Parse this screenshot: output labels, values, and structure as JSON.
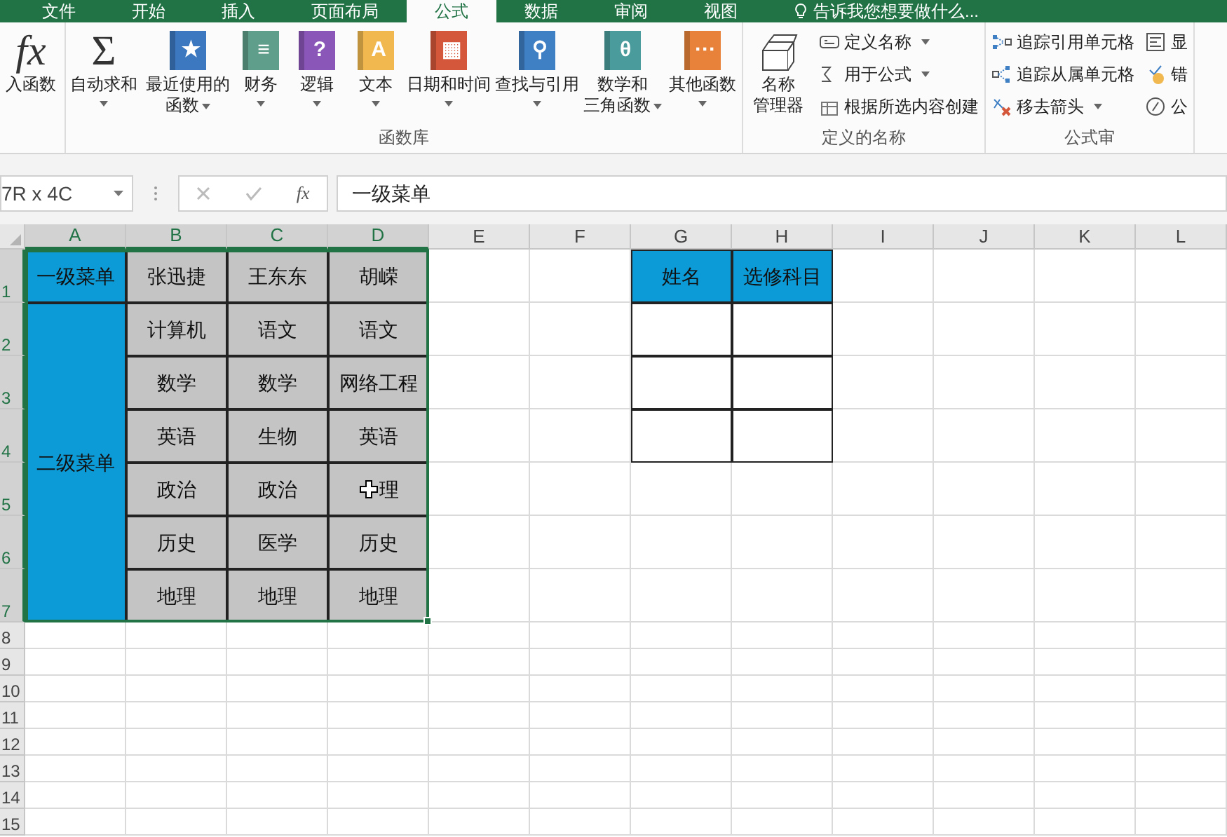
{
  "tabs": [
    {
      "label": "文件",
      "selected": false
    },
    {
      "label": "开始",
      "selected": false
    },
    {
      "label": "插入",
      "selected": false
    },
    {
      "label": "页面布局",
      "selected": false
    },
    {
      "label": "公式",
      "selected": true
    },
    {
      "label": "数据",
      "selected": false
    },
    {
      "label": "审阅",
      "selected": false
    },
    {
      "label": "视图",
      "selected": false
    }
  ],
  "tell_me": "告诉我您想要做什么...",
  "ribbon_groups": [
    {
      "items": [
        {
          "kind": "large",
          "glyph": "fx",
          "lines": [
            "入函数"
          ],
          "dropdown": false
        }
      ]
    },
    {
      "label": "函数库",
      "items": [
        {
          "kind": "large",
          "glyph": "Σ",
          "lines": [
            "自动求和"
          ],
          "dropdown": true
        },
        {
          "kind": "large",
          "glyph": "★",
          "color": "#3b78c0",
          "lines": [
            "最近使用的",
            "函数"
          ],
          "dropdown": true
        },
        {
          "kind": "large",
          "glyph": "≡",
          "color": "#5f9e8a",
          "lines": [
            "财务"
          ],
          "dropdown": true
        },
        {
          "kind": "large",
          "glyph": "?",
          "color": "#8a56b8",
          "lines": [
            "逻辑"
          ],
          "dropdown": true
        },
        {
          "kind": "large",
          "glyph": "A",
          "color": "#f0b84e",
          "lines": [
            "文本"
          ],
          "dropdown": true
        },
        {
          "kind": "large",
          "glyph": "▦",
          "color": "#d4573b",
          "lines": [
            "日期和时间"
          ],
          "dropdown": true
        },
        {
          "kind": "large",
          "glyph": "⚲",
          "color": "#3f7fc4",
          "lines": [
            "查找与引用"
          ],
          "dropdown": true
        },
        {
          "kind": "large",
          "glyph": "θ",
          "color": "#4a9b9b",
          "lines": [
            "数学和",
            "三角函数"
          ],
          "dropdown": true
        },
        {
          "kind": "large",
          "glyph": "···",
          "color": "#e8823a",
          "lines": [
            "其他函数"
          ],
          "dropdown": true
        }
      ]
    },
    {
      "label": "定义的名称",
      "items": [
        {
          "kind": "large",
          "lines": [
            "名称",
            "管理器"
          ],
          "dropdown": false
        },
        {
          "kind": "small",
          "lines": [
            "定义名称"
          ],
          "dropdown": true
        },
        {
          "kind": "small",
          "lines": [
            "用于公式"
          ],
          "dropdown": true
        },
        {
          "kind": "small",
          "lines": [
            "根据所选内容创建"
          ],
          "dropdown": false
        }
      ]
    },
    {
      "label": "公式审",
      "items": [
        {
          "kind": "small",
          "lines": [
            "追踪引用单元格"
          ],
          "dropdown": false
        },
        {
          "kind": "small",
          "lines": [
            "追踪从属单元格"
          ],
          "dropdown": false
        },
        {
          "kind": "small",
          "lines": [
            "移去箭头"
          ],
          "dropdown": true
        },
        {
          "kind": "small",
          "lines": [
            "显"
          ],
          "dropdown": false
        },
        {
          "kind": "small",
          "lines": [
            "错"
          ],
          "dropdown": false
        },
        {
          "kind": "small",
          "lines": [
            "公"
          ],
          "dropdown": false
        }
      ]
    }
  ],
  "formula_bar": {
    "name_box": "7R x 4C",
    "fx": "fx",
    "value": "一级菜单"
  },
  "columns": [
    {
      "label": "A",
      "selected": true
    },
    {
      "label": "B",
      "selected": true
    },
    {
      "label": "C",
      "selected": true
    },
    {
      "label": "D",
      "selected": true
    },
    {
      "label": "E",
      "selected": false
    },
    {
      "label": "F",
      "selected": false
    },
    {
      "label": "G",
      "selected": false
    },
    {
      "label": "H",
      "selected": false
    },
    {
      "label": "I",
      "selected": false
    },
    {
      "label": "J",
      "selected": false
    },
    {
      "label": "K",
      "selected": false
    },
    {
      "label": "L",
      "selected": false
    }
  ],
  "rows": [
    {
      "label": "1",
      "selected": true
    },
    {
      "label": "2",
      "selected": true
    },
    {
      "label": "3",
      "selected": true
    },
    {
      "label": "4",
      "selected": true
    },
    {
      "label": "5",
      "selected": true
    },
    {
      "label": "6",
      "selected": true
    },
    {
      "label": "7",
      "selected": true
    },
    {
      "label": "8",
      "selected": false
    },
    {
      "label": "9",
      "selected": false
    },
    {
      "label": "10",
      "selected": false
    },
    {
      "label": "11",
      "selected": false
    },
    {
      "label": "12",
      "selected": false
    },
    {
      "label": "13",
      "selected": false
    },
    {
      "label": "14",
      "selected": false
    },
    {
      "label": "15",
      "selected": false
    }
  ],
  "menu_table": {
    "corner": "一级菜单",
    "header": [
      "张迅捷",
      "王东东",
      "胡嵘"
    ],
    "side": "二级菜单",
    "body": [
      [
        "计算机",
        "语文",
        "语文"
      ],
      [
        "数学",
        "数学",
        "网络工程"
      ],
      [
        "英语",
        "生物",
        "英语"
      ],
      [
        "政治",
        "政治",
        "理"
      ],
      [
        "历史",
        "医学",
        "历史"
      ],
      [
        "地理",
        "地理",
        "地理"
      ]
    ]
  },
  "pick_table": {
    "header": [
      "姓名",
      "选修科目"
    ]
  }
}
